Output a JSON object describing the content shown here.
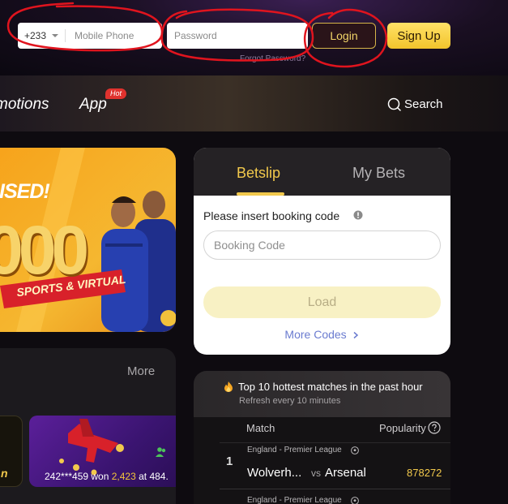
{
  "header": {
    "phone_code": "+233",
    "phone_placeholder": "Mobile Phone",
    "password_placeholder": "Password",
    "forgot_password": "Forgot Password?",
    "login_label": "Login",
    "signup_label": "Sign Up",
    "annotation_color": "#e0141e"
  },
  "nav": {
    "items": [
      {
        "label": "motions"
      },
      {
        "label": "App",
        "badge": "Hot"
      }
    ],
    "search_label": "Search"
  },
  "banner": {
    "headline": "AISED!",
    "big_number": "000",
    "tagline": "SPORTS & VIRTUAL"
  },
  "betslip": {
    "tabs": [
      {
        "label": "Betslip",
        "active": true
      },
      {
        "label": "My Bets",
        "active": false
      }
    ],
    "booking_label": "Please insert booking code",
    "booking_placeholder": "Booking Code",
    "load_label": "Load",
    "more_codes_label": "More Codes"
  },
  "games": {
    "more_label": "More",
    "tile_text_left": "n",
    "win_user": "242***459 won ",
    "win_amount": "2,423",
    "win_suffix": " at 484."
  },
  "hottest": {
    "title": "Top 10 hottest matches in the past hour",
    "subtitle": "Refresh every 10 minutes",
    "col_match": "Match",
    "col_popularity": "Popularity",
    "matches": [
      {
        "rank": "1",
        "league": "England - Premier League",
        "home": "Wolverh...",
        "vs": "vs",
        "away": "Arsenal",
        "popularity": "878272"
      },
      {
        "league": "England - Premier League"
      }
    ]
  },
  "colors": {
    "accent_gold": "#f2c94c",
    "signup_yellow": "#f8d23a",
    "link_blue": "#6b7cd0",
    "hot_badge_red": "#e0322e"
  }
}
